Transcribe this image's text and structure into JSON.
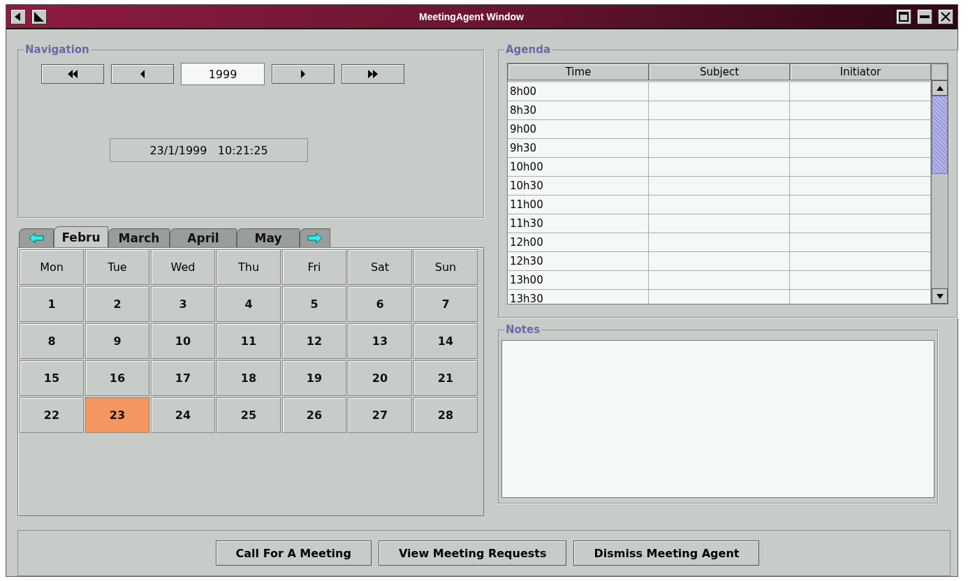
{
  "window": {
    "title": "MeetingAgent Window"
  },
  "navigation": {
    "title": "Navigation",
    "year": "1999",
    "datetime": "23/1/1999   10:21:25"
  },
  "calendar": {
    "tabs": [
      {
        "kind": "prev",
        "selected": false
      },
      {
        "kind": "month",
        "label": "Febru",
        "selected": true
      },
      {
        "kind": "month",
        "label": "March",
        "selected": false
      },
      {
        "kind": "month",
        "label": "April",
        "selected": false
      },
      {
        "kind": "month",
        "label": "May",
        "selected": false
      },
      {
        "kind": "next",
        "selected": false
      }
    ],
    "weekdays": [
      "Mon",
      "Tue",
      "Wed",
      "Thu",
      "Fri",
      "Sat",
      "Sun"
    ],
    "weeks": [
      [
        {
          "day": "1",
          "selected": false
        },
        {
          "day": "2",
          "selected": false
        },
        {
          "day": "3",
          "selected": false
        },
        {
          "day": "4",
          "selected": false
        },
        {
          "day": "5",
          "selected": false
        },
        {
          "day": "6",
          "selected": false
        },
        {
          "day": "7",
          "selected": false
        }
      ],
      [
        {
          "day": "8",
          "selected": false
        },
        {
          "day": "9",
          "selected": false
        },
        {
          "day": "10",
          "selected": false
        },
        {
          "day": "11",
          "selected": false
        },
        {
          "day": "12",
          "selected": false
        },
        {
          "day": "13",
          "selected": false
        },
        {
          "day": "14",
          "selected": false
        }
      ],
      [
        {
          "day": "15",
          "selected": false
        },
        {
          "day": "16",
          "selected": false
        },
        {
          "day": "17",
          "selected": false
        },
        {
          "day": "18",
          "selected": false
        },
        {
          "day": "19",
          "selected": false
        },
        {
          "day": "20",
          "selected": false
        },
        {
          "day": "21",
          "selected": false
        }
      ],
      [
        {
          "day": "22",
          "selected": false
        },
        {
          "day": "23",
          "selected": true
        },
        {
          "day": "24",
          "selected": false
        },
        {
          "day": "25",
          "selected": false
        },
        {
          "day": "26",
          "selected": false
        },
        {
          "day": "27",
          "selected": false
        },
        {
          "day": "28",
          "selected": false
        }
      ]
    ]
  },
  "agenda": {
    "title": "Agenda",
    "columns": [
      "Time",
      "Subject",
      "Initiator"
    ],
    "rows": [
      {
        "time": "8h00"
      },
      {
        "time": "8h30"
      },
      {
        "time": "9h00"
      },
      {
        "time": "9h30"
      },
      {
        "time": "10h00"
      },
      {
        "time": "10h30"
      },
      {
        "time": "11h00"
      },
      {
        "time": "11h30"
      },
      {
        "time": "12h00"
      },
      {
        "time": "12h30"
      },
      {
        "time": "13h00"
      },
      {
        "time": "13h30"
      }
    ]
  },
  "notes": {
    "title": "Notes"
  },
  "actions": [
    "Call For A Meeting",
    "View Meeting Requests",
    "Dismiss Meeting Agent"
  ]
}
